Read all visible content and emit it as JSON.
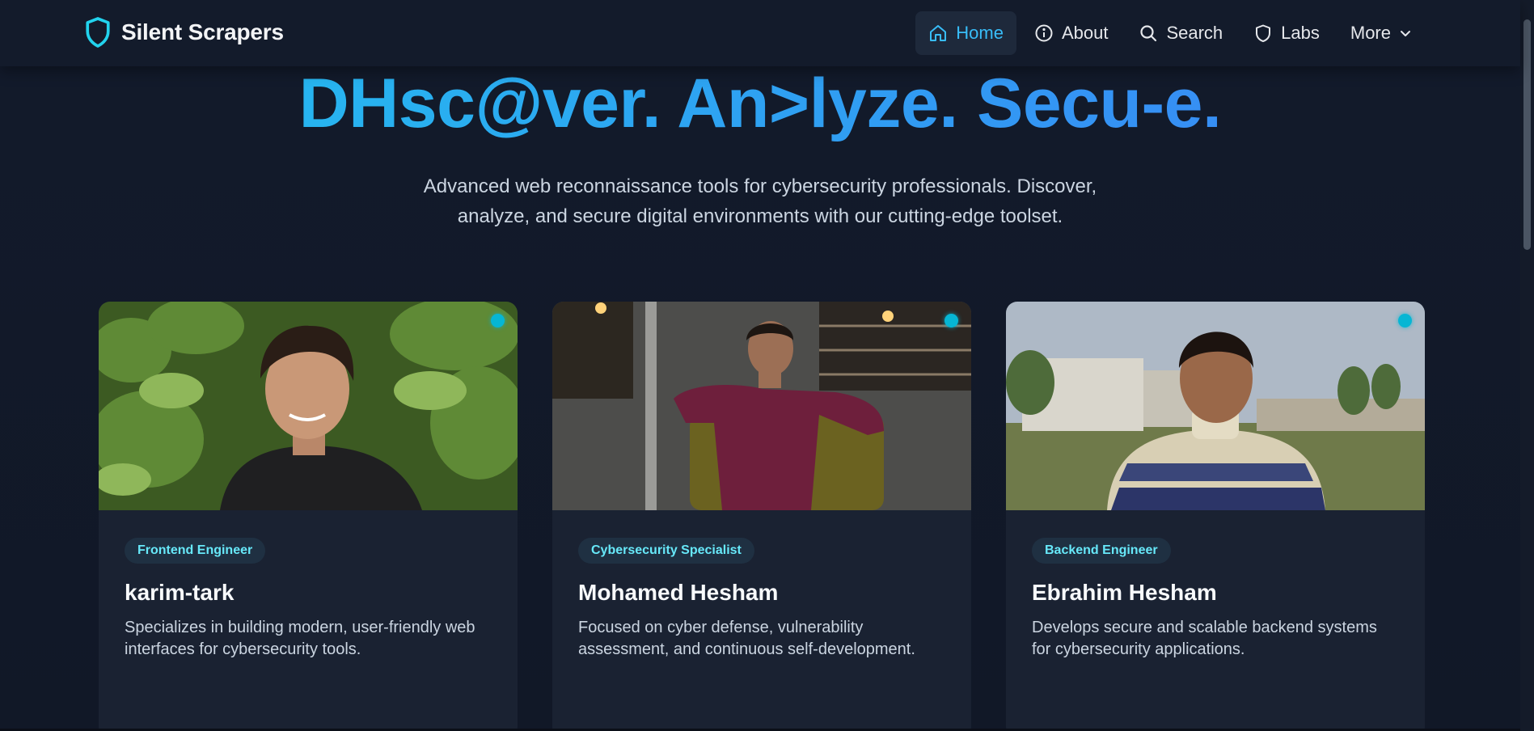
{
  "brand": {
    "name": "Silent Scrapers",
    "icon": "shield-icon"
  },
  "nav": {
    "items": [
      {
        "label": "Home",
        "icon": "home-icon",
        "active": true
      },
      {
        "label": "About",
        "icon": "info-icon"
      },
      {
        "label": "Search",
        "icon": "search-icon"
      },
      {
        "label": "Labs",
        "icon": "shield-icon"
      },
      {
        "label": "More",
        "icon": "chevron-down-icon"
      }
    ]
  },
  "hero": {
    "title": "DHsc@ver. An>lyze. Secu-e.",
    "subtitle_line1": "Advanced web reconnaissance tools for cybersecurity professionals. Discover,",
    "subtitle_line2": "analyze, and secure digital environments with our cutting-edge toolset."
  },
  "team": [
    {
      "role": "Frontend Engineer",
      "name": "karim-tark",
      "description": "Specializes in building modern, user-friendly web interfaces for cybersecurity tools."
    },
    {
      "role": "Cybersecurity Specialist",
      "name": "Mohamed Hesham",
      "description": "Focused on cyber defense, vulnerability assessment, and continuous self-development."
    },
    {
      "role": "Backend Engineer",
      "name": "Ebrahim Hesham",
      "description": "Develops secure and scalable backend systems for cybersecurity applications."
    }
  ],
  "colors": {
    "accent": "#22d3ee",
    "gradient_start": "#22c1ee",
    "gradient_end": "#3b82f6",
    "background": "#111827",
    "card": "#1a2232"
  }
}
